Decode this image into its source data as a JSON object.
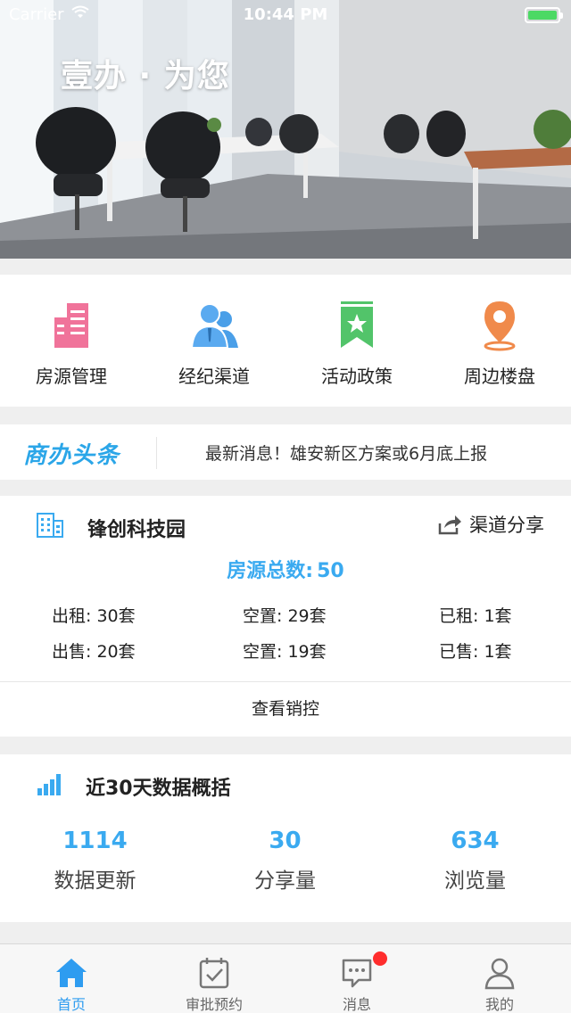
{
  "status_bar": {
    "carrier": "Carrier",
    "time": "10:44 PM"
  },
  "hero": {
    "slogan": "壹办 · 为您"
  },
  "quick_menu": [
    {
      "label": "房源管理",
      "icon": "building-list-icon",
      "color": "#f0739a"
    },
    {
      "label": "经纪渠道",
      "icon": "agents-icon",
      "color": "#4a9fe8"
    },
    {
      "label": "活动政策",
      "icon": "bookmark-star-icon",
      "color": "#52c46a"
    },
    {
      "label": "周边楼盘",
      "icon": "location-pin-icon",
      "color": "#f08a4b"
    }
  ],
  "headline": {
    "logo": "商办头条",
    "news": "最新消息！雄安新区方案或6月底上报"
  },
  "property": {
    "name": "锋创科技园",
    "share_label": "渠道分享",
    "total_label": "房源总数:",
    "total_value": "50",
    "stats": [
      [
        "出租: 30套",
        "空置: 29套",
        "已租: 1套"
      ],
      [
        "出售: 20套",
        "空置: 19套",
        "已售: 1套"
      ]
    ],
    "view_label": "查看销控"
  },
  "summary": {
    "title": "近30天数据概括",
    "metrics": [
      {
        "value": "1114",
        "label": "数据更新"
      },
      {
        "value": "30",
        "label": "分享量"
      },
      {
        "value": "634",
        "label": "浏览量"
      }
    ]
  },
  "tabs": [
    {
      "label": "首页",
      "icon": "home-icon",
      "active": true
    },
    {
      "label": "审批预约",
      "icon": "approval-icon",
      "active": false
    },
    {
      "label": "消息",
      "icon": "message-icon",
      "active": false
    },
    {
      "label": "我的",
      "icon": "profile-icon",
      "active": false
    }
  ],
  "colors": {
    "accent": "#3aaaf0",
    "tab_active": "#2e9cf0",
    "badge": "#ff2d2d"
  }
}
